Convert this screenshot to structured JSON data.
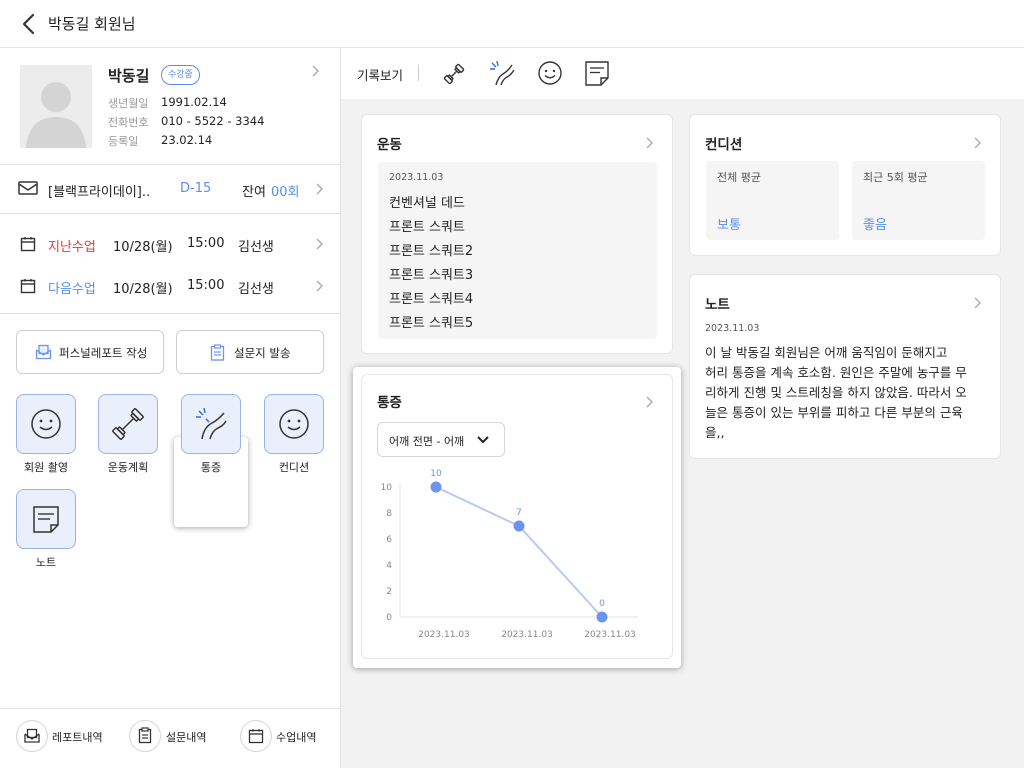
{
  "header": {
    "title": "박동길 회원님"
  },
  "member": {
    "name": "박동길",
    "badge": "수강중",
    "birth_label": "생년월일",
    "birth": "1991.02.14",
    "phone_label": "전화번호",
    "phone": "010 - 5522 - 3344",
    "reg_label": "등록일",
    "reg": "23.02.14"
  },
  "ticket": {
    "name": "[블랙프라이데이]..",
    "dday": "D-15",
    "remain_label": "잔여",
    "remain": "00회"
  },
  "lessons": [
    {
      "label": "지난수업",
      "date": "10/28(월)",
      "time": "15:00",
      "teacher": "김선생"
    },
    {
      "label": "다음수업",
      "date": "10/28(월)",
      "time": "15:00",
      "teacher": "김선생"
    }
  ],
  "actions": {
    "report": "퍼스널레포트 작성",
    "survey": "설문지 발송"
  },
  "tiles": [
    "회원 촬영",
    "운동계획",
    "통증",
    "컨디션",
    "노트"
  ],
  "bottom": {
    "reports": "레포트내역",
    "surveys": "설문내역",
    "classes": "수업내역"
  },
  "toolbar": {
    "label": "기록보기"
  },
  "exercise": {
    "title": "운동",
    "date": "2023.11.03",
    "items": [
      "컨벤셔널 데드",
      "프론트 스쿼트",
      "프론트 스쿼트2",
      "프론트 스쿼트3",
      "프론트 스쿼트4",
      "프론트 스쿼트5"
    ]
  },
  "condition": {
    "title": "컨디션",
    "overall_label": "전체 평균",
    "overall": "보통",
    "recent_label": "최근 5회 평균",
    "recent": "좋음"
  },
  "note": {
    "title": "노트",
    "date": "2023.11.03",
    "lines": [
      "이 날 박동길 회원님은 어깨 움직임이 둔해지고",
      "허리 통증을 계속 호소함. 원인은 주말에 농구를 무",
      "리하게 진행 및 스트레칭을 하지 않았음. 따라서 오",
      "늘은 통증이 있는 부위를 피하고 다른 부분의 근육",
      "을,,"
    ]
  },
  "pain": {
    "title": "통증",
    "select": "어깨 전면 - 어깨"
  },
  "chart_data": {
    "type": "line",
    "categories": [
      "2023.11.03",
      "2023.11.03",
      "2023.11.03"
    ],
    "values": [
      10,
      7,
      0
    ],
    "yticks": [
      0,
      2,
      4,
      6,
      8,
      10
    ],
    "ylim": [
      0,
      10
    ],
    "grid": false,
    "color": "#6b93f0"
  },
  "colors": {
    "accent": "#5b8def",
    "past": "#e53935",
    "next": "#5b8def"
  }
}
